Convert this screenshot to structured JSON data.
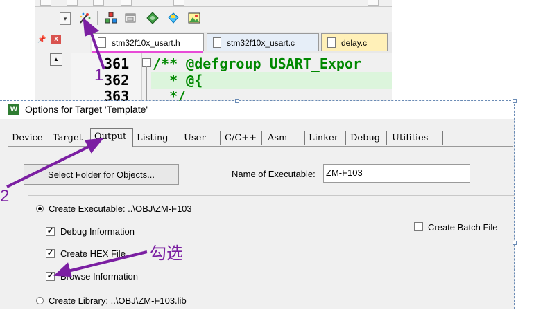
{
  "ide": {
    "file_tabs": [
      {
        "label": "stm32f10x_usart.h",
        "active": true
      },
      {
        "label": "stm32f10x_usart.c",
        "active": false
      },
      {
        "label": "delay.c",
        "active": false
      }
    ],
    "line_numbers": [
      "361",
      "362",
      "363"
    ],
    "code_lines": [
      "/** @defgroup USART_Expor",
      "  * @{",
      "  */"
    ],
    "toolbar_icons": [
      "dropdown-icon",
      "magic-wand-icon",
      "rebuild-icon",
      "window-icon",
      "diamond-icon",
      "flag-icon",
      "picture-icon"
    ]
  },
  "dialog": {
    "title": "Options for Target 'Template'",
    "tabs": [
      "Device",
      "Target",
      "Output",
      "Listing",
      "User",
      "C/C++",
      "Asm",
      "Linker",
      "Debug",
      "Utilities"
    ],
    "active_tab": "Output",
    "select_folder_button": "Select Folder for Objects...",
    "name_of_executable_label": "Name of Executable:",
    "name_of_executable_value": "ZM-F103",
    "create_executable_label": "Create Executable:  ..\\OBJ\\ZM-F103",
    "debug_info_label": "Debug Information",
    "create_hex_label": "Create HEX File",
    "browse_info_label": "Browse Information",
    "create_library_label": "Create Library:  ..\\OBJ\\ZM-F103.lib",
    "create_batch_label": "Create Batch File"
  },
  "annotations": {
    "step1": "1",
    "step2": "2",
    "check_note": "勾选"
  },
  "colors": {
    "annotation": "#7b1fa2",
    "active_tab_marker": "#e84bd7",
    "comment_green": "#008800"
  }
}
